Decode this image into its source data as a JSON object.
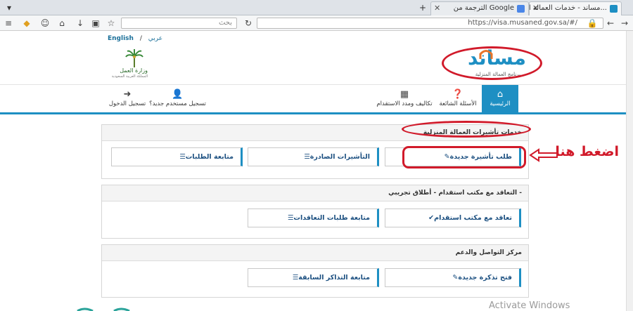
{
  "browser": {
    "tabs": [
      {
        "title": "مساند - خدمات العمالة ا...",
        "active": true,
        "favicon_color": "#1e8fc3"
      },
      {
        "title": "الترجمة من Google",
        "active": false,
        "favicon_color": "#4a86e8"
      }
    ],
    "search_placeholder": "بحث",
    "url": "https://visa.musaned.gov.sa/#/"
  },
  "header": {
    "lang_english": "English",
    "lang_separator": "/",
    "lang_arabic": "عربي",
    "ministry_name": "وزارة العمل",
    "ministry_sub": "المملكة العربية السعودية",
    "logo_word": "مساند",
    "logo_tagline": "برنامج العمالة المنزلية"
  },
  "nav": {
    "items": [
      {
        "label": "الرئيسية",
        "icon": "home-icon",
        "active": true
      },
      {
        "label": "الأسئلة الشائعة",
        "icon": "question-icon",
        "active": false
      },
      {
        "label": "تكاليف ومدد الاستقدام",
        "icon": "calculator-icon",
        "active": false
      },
      {
        "label": "تسجيل مستخدم جديد؟",
        "icon": "user-plus-icon",
        "active": false
      },
      {
        "label": "تسجيل الدخول",
        "icon": "sign-in-icon",
        "active": false
      }
    ]
  },
  "sections": {
    "visa": {
      "title": "خدمات تأشيرات العمالة المنزلية",
      "cards": [
        "طلب تأشيرة جديدة",
        "التأشيرات الصادرة",
        "متابعة الطلبات"
      ]
    },
    "contract": {
      "title": "التعاقد مع مكتب استقدام - أطلاق تجريبي -",
      "cards": [
        "تعاقد مع مكتب استقدام",
        "متابعة طلبات التعاقدات"
      ]
    },
    "support": {
      "title": "مركز التواصل والدعم",
      "cards": [
        "فتح تذكرة جديدة",
        "متابعة التذاكر السابقة"
      ]
    }
  },
  "annotation": {
    "text": "اضغط هنا",
    "color": "#d11a2a"
  },
  "watermark": "Activate Windows",
  "colors": {
    "accent": "#1e8fc3",
    "annotation": "#d11a2a"
  }
}
